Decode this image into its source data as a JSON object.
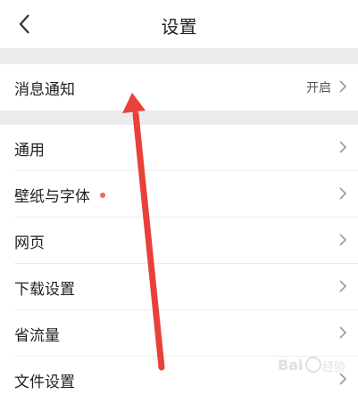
{
  "header": {
    "title": "设置"
  },
  "section1": {
    "items": [
      {
        "label": "消息通知",
        "value": "开启"
      }
    ]
  },
  "section2": {
    "items": [
      {
        "label": "通用"
      },
      {
        "label": "壁纸与字体",
        "has_dot": true
      },
      {
        "label": "网页"
      },
      {
        "label": "下载设置"
      },
      {
        "label": "省流量"
      },
      {
        "label": "文件设置"
      }
    ]
  },
  "colors": {
    "dot": "#ef6a55",
    "arrow": "#e8403a",
    "divider": "#ececec"
  },
  "icons": {
    "back": "chevron-left-icon",
    "row_arrow": "chevron-right-icon"
  }
}
